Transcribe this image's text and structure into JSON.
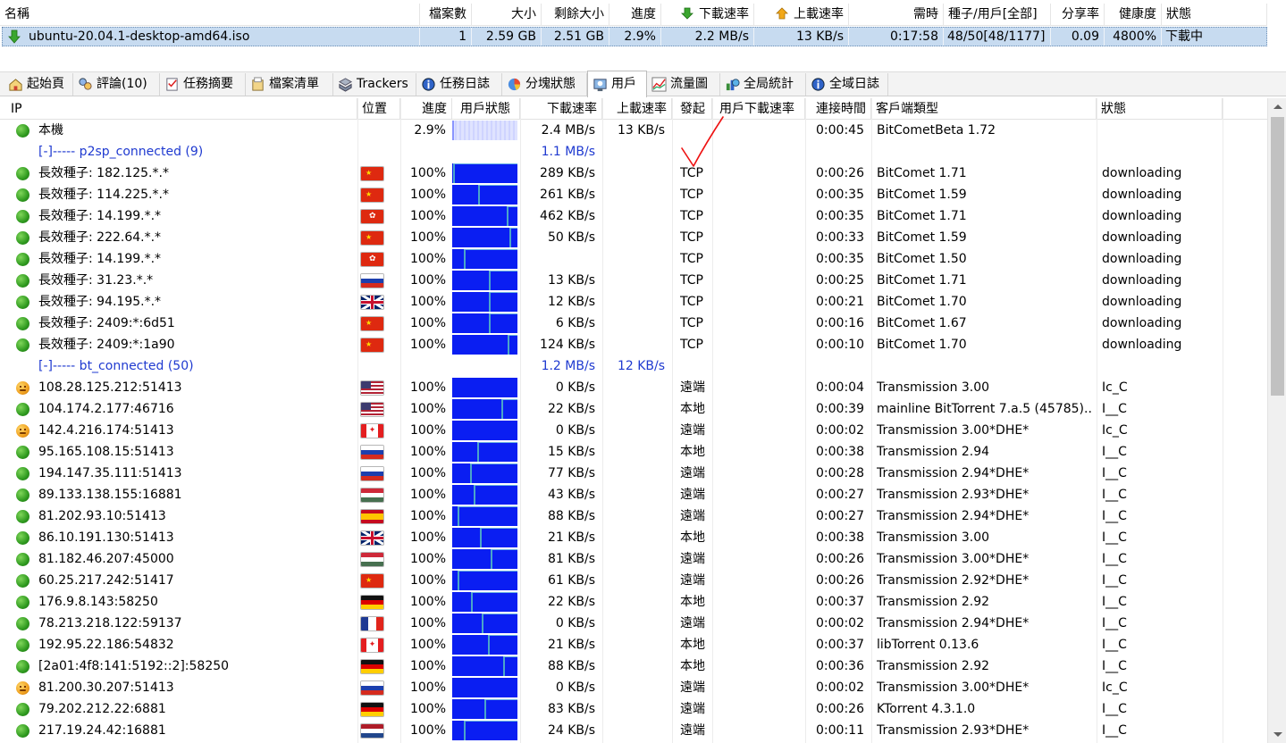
{
  "task_table": {
    "headers": [
      "名稱",
      "檔案數",
      "大小",
      "剩餘大小",
      "進度",
      "下載速率",
      "上載速率",
      "需時",
      "種子/用戶[全部]",
      "分享率",
      "健康度",
      "狀態"
    ],
    "row": {
      "name": "ubuntu-20.04.1-desktop-amd64.iso",
      "files": "1",
      "size": "2.59 GB",
      "remaining": "2.51 GB",
      "progress": "2.9%",
      "down_rate": "2.2 MB/s",
      "up_rate": "13 KB/s",
      "eta": "0:17:58",
      "seeds": "48/50[48/1177]",
      "share": "0.09",
      "health": "4800%",
      "status": "下載中"
    }
  },
  "tabs": [
    "起始頁",
    "評論(10)",
    "任務摘要",
    "檔案清單",
    "Trackers",
    "任務日誌",
    "分塊狀態",
    "用戶",
    "流量圖",
    "全局統計",
    "全域日誌"
  ],
  "active_tab": "用戶",
  "peer_headers": [
    "IP",
    "位置",
    "進度",
    "用戶狀態",
    "下載速率",
    "上載速率",
    "發起",
    "用戶下載速率",
    "連接時間",
    "客戶端類型",
    "狀態"
  ],
  "peers": [
    {
      "kind": "self",
      "ip": "本機",
      "progress": "2.9%",
      "down": "2.4 MB/s",
      "up": "13 KB/s",
      "init": "",
      "time": "0:00:45",
      "client": "BitCometBeta 1.72",
      "state": "",
      "bar": 0.0292
    },
    {
      "kind": "group",
      "ip": "[-]----- p2sp_connected (9)",
      "down": "1.1 MB/s",
      "up": ""
    },
    {
      "kind": "peer",
      "icon": "good",
      "ip": "長效種子: 182.125.*.*",
      "flag": "cn",
      "progress": "100%",
      "down": "289 KB/s",
      "init": "TCP",
      "time": "0:00:26",
      "client": "BitComet 1.71",
      "state": "downloading",
      "bar": 1,
      "mk": 0.02
    },
    {
      "kind": "peer",
      "icon": "good",
      "ip": "長效種子: 114.225.*.*",
      "flag": "cn",
      "progress": "100%",
      "down": "261 KB/s",
      "init": "TCP",
      "time": "0:00:35",
      "client": "BitComet 1.59",
      "state": "downloading",
      "bar": 1,
      "mk": 0.41
    },
    {
      "kind": "peer",
      "icon": "good",
      "ip": "長效種子: 14.199.*.*",
      "flag": "hk",
      "progress": "100%",
      "down": "462 KB/s",
      "init": "TCP",
      "time": "0:00:35",
      "client": "BitComet 1.71",
      "state": "downloading",
      "bar": 1,
      "mk": 0.86
    },
    {
      "kind": "peer",
      "icon": "good",
      "ip": "長效種子: 222.64.*.*",
      "flag": "cn",
      "progress": "100%",
      "down": "50 KB/s",
      "init": "TCP",
      "time": "0:00:33",
      "client": "BitComet 1.59",
      "state": "downloading",
      "bar": 1,
      "mk": 0.9
    },
    {
      "kind": "peer",
      "icon": "good",
      "ip": "長效種子: 14.199.*.*",
      "flag": "hk",
      "progress": "100%",
      "down": "",
      "init": "TCP",
      "time": "0:00:35",
      "client": "BitComet 1.50",
      "state": "downloading",
      "bar": 1,
      "mk": 0.18
    },
    {
      "kind": "peer",
      "icon": "good",
      "ip": "長效種子: 31.23.*.*",
      "flag": "ru",
      "progress": "100%",
      "down": "13 KB/s",
      "init": "TCP",
      "time": "0:00:25",
      "client": "BitComet 1.71",
      "state": "downloading",
      "bar": 1,
      "mk": 0.58
    },
    {
      "kind": "peer",
      "icon": "good",
      "ip": "長效種子: 94.195.*.*",
      "flag": "gb",
      "progress": "100%",
      "down": "12 KB/s",
      "init": "TCP",
      "time": "0:00:21",
      "client": "BitComet 1.70",
      "state": "downloading",
      "bar": 1,
      "mk": 0.58
    },
    {
      "kind": "peer",
      "icon": "good",
      "ip": "長效種子: 2409:*:6d51",
      "flag": "cn",
      "progress": "100%",
      "down": "6 KB/s",
      "init": "TCP",
      "time": "0:00:16",
      "client": "BitComet 1.67",
      "state": "downloading",
      "bar": 1,
      "mk": 0.58
    },
    {
      "kind": "peer",
      "icon": "good",
      "ip": "長效種子: 2409:*:1a90",
      "flag": "cn",
      "progress": "100%",
      "down": "124 KB/s",
      "init": "TCP",
      "time": "0:00:10",
      "client": "BitComet 1.70",
      "state": "downloading",
      "bar": 1,
      "mk": 0.88
    },
    {
      "kind": "group",
      "ip": "[-]----- bt_connected (50)",
      "down": "1.2 MB/s",
      "up": "12 KB/s"
    },
    {
      "kind": "peer",
      "icon": "bad",
      "ip": "108.28.125.212:51413",
      "flag": "us",
      "progress": "100%",
      "down": "0 KB/s",
      "init": "遠端",
      "time": "0:00:04",
      "client": "Transmission 3.00",
      "state": "Ic_C",
      "bar": 1,
      "mk": -1
    },
    {
      "kind": "peer",
      "icon": "good",
      "ip": "104.174.2.177:46716",
      "flag": "us",
      "progress": "100%",
      "down": "22 KB/s",
      "init": "本地",
      "time": "0:00:39",
      "client": "mainline BitTorrent 7.a.5 (45785)...",
      "state": "I__C",
      "bar": 1,
      "mk": 0.78
    },
    {
      "kind": "peer",
      "icon": "bad",
      "ip": "142.4.216.174:51413",
      "flag": "ca",
      "progress": "100%",
      "down": "0 KB/s",
      "init": "遠端",
      "time": "0:00:02",
      "client": "Transmission 3.00*DHE*",
      "state": "Ic_C",
      "bar": 1,
      "mk": -1
    },
    {
      "kind": "peer",
      "icon": "good",
      "ip": "95.165.108.15:51413",
      "flag": "ru",
      "progress": "100%",
      "down": "15 KB/s",
      "init": "本地",
      "time": "0:00:38",
      "client": "Transmission 2.94",
      "state": "I__C",
      "bar": 1,
      "mk": 0.4
    },
    {
      "kind": "peer",
      "icon": "good",
      "ip": "194.147.35.111:51413",
      "flag": "ru",
      "progress": "100%",
      "down": "77 KB/s",
      "init": "遠端",
      "time": "0:00:28",
      "client": "Transmission 2.94*DHE*",
      "state": "I__C",
      "bar": 1,
      "mk": 0.28
    },
    {
      "kind": "peer",
      "icon": "good",
      "ip": "89.133.138.155:16881",
      "flag": "hu",
      "progress": "100%",
      "down": "43 KB/s",
      "init": "遠端",
      "time": "0:00:27",
      "client": "Transmission 2.93*DHE*",
      "state": "I__C",
      "bar": 1,
      "mk": 0.34
    },
    {
      "kind": "peer",
      "icon": "good",
      "ip": "81.202.93.10:51413",
      "flag": "es",
      "progress": "100%",
      "down": "88 KB/s",
      "init": "遠端",
      "time": "0:00:27",
      "client": "Transmission 2.94*DHE*",
      "state": "I__C",
      "bar": 1,
      "mk": 0.08
    },
    {
      "kind": "peer",
      "icon": "good",
      "ip": "86.10.191.130:51413",
      "flag": "gb",
      "progress": "100%",
      "down": "21 KB/s",
      "init": "本地",
      "time": "0:00:38",
      "client": "Transmission 3.00",
      "state": "I__C",
      "bar": 1,
      "mk": 0.44
    },
    {
      "kind": "peer",
      "icon": "good",
      "ip": "81.182.46.207:45000",
      "flag": "hu",
      "progress": "100%",
      "down": "81 KB/s",
      "init": "遠端",
      "time": "0:00:26",
      "client": "Transmission 3.00*DHE*",
      "state": "I__C",
      "bar": 1,
      "mk": 0.6
    },
    {
      "kind": "peer",
      "icon": "good",
      "ip": "60.25.217.242:51417",
      "flag": "cn",
      "progress": "100%",
      "down": "61 KB/s",
      "init": "遠端",
      "time": "0:00:26",
      "client": "Transmission 2.92*DHE*",
      "state": "I__C",
      "bar": 1,
      "mk": 0.08
    },
    {
      "kind": "peer",
      "icon": "good",
      "ip": "176.9.8.143:58250",
      "flag": "de",
      "progress": "100%",
      "down": "22 KB/s",
      "init": "本地",
      "time": "0:00:37",
      "client": "Transmission 2.92",
      "state": "I__C",
      "bar": 1,
      "mk": 0.3
    },
    {
      "kind": "peer",
      "icon": "good",
      "ip": "78.213.218.122:59137",
      "flag": "fr",
      "progress": "100%",
      "down": "0 KB/s",
      "init": "遠端",
      "time": "0:00:02",
      "client": "Transmission 2.94*DHE*",
      "state": "I__C",
      "bar": 1,
      "mk": 0.46
    },
    {
      "kind": "peer",
      "icon": "good",
      "ip": "192.95.22.186:54832",
      "flag": "ca",
      "progress": "100%",
      "down": "21 KB/s",
      "init": "本地",
      "time": "0:00:37",
      "client": "libTorrent 0.13.6",
      "state": "I__C",
      "bar": 1,
      "mk": 0.56
    },
    {
      "kind": "peer",
      "icon": "good",
      "ip": "[2a01:4f8:141:5192::2]:58250",
      "flag": "de",
      "progress": "100%",
      "down": "88 KB/s",
      "init": "本地",
      "time": "0:00:36",
      "client": "Transmission 2.92",
      "state": "I__C",
      "bar": 1,
      "mk": 0.8
    },
    {
      "kind": "peer",
      "icon": "bad",
      "ip": "81.200.30.207:51413",
      "flag": "ru",
      "progress": "100%",
      "down": "0 KB/s",
      "init": "遠端",
      "time": "0:00:02",
      "client": "Transmission 3.00*DHE*",
      "state": "Ic_C",
      "bar": 1,
      "mk": -1
    },
    {
      "kind": "peer",
      "icon": "good",
      "ip": "79.202.212.22:6881",
      "flag": "de",
      "progress": "100%",
      "down": "83 KB/s",
      "init": "遠端",
      "time": "0:00:26",
      "client": "KTorrent 4.3.1.0",
      "state": "I__C",
      "bar": 1,
      "mk": 0.5
    },
    {
      "kind": "peer",
      "icon": "good",
      "ip": "217.19.24.42:16881",
      "flag": "nl",
      "progress": "100%",
      "down": "24 KB/s",
      "init": "遠端",
      "time": "0:00:11",
      "client": "Transmission 2.93*DHE*",
      "state": "I__C",
      "bar": 1,
      "mk": 0.18
    }
  ]
}
